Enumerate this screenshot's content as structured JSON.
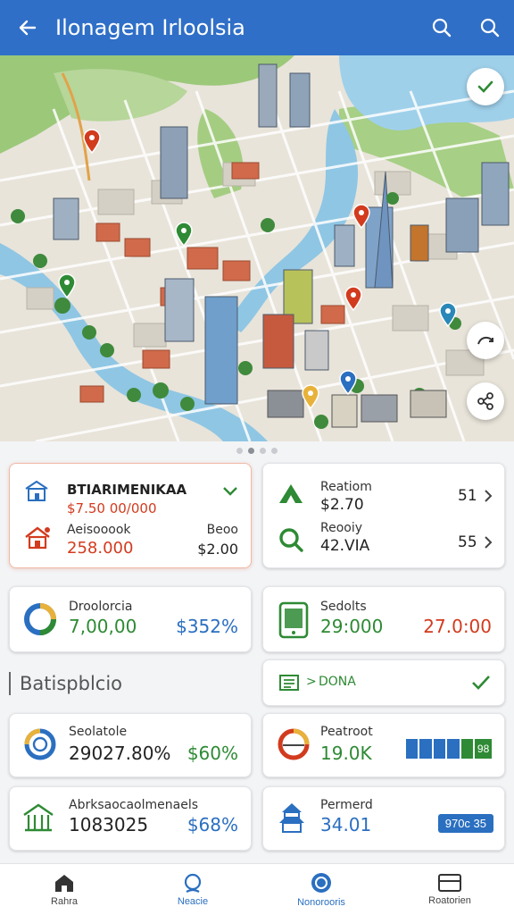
{
  "header": {
    "title": "Ilonagem Irloolsia",
    "back_icon": "arrow-left-icon",
    "search_icons": [
      "search-icon",
      "search-icon"
    ],
    "bg_color": "#2f6fc7"
  },
  "map": {
    "pager": {
      "count": 4,
      "active": 1
    }
  },
  "cards": {
    "c1": {
      "title": "BTIARIMENIKAA",
      "subtitle": "$7.50 00/000",
      "row_label": "Aeisooook",
      "row_value": "258.000",
      "right_label": "Beoo",
      "right_value": "$2.00"
    },
    "c2": {
      "label1": "Reatiom",
      "value1": "$2.70",
      "num1": "51",
      "label2": "Reooiy",
      "value2": "42.VIA",
      "num2": "55"
    },
    "c3": {
      "label": "Droolorcia",
      "value": "7,00,00",
      "percent": "$352%"
    },
    "c4": {
      "label": "Sedolts",
      "value": "29:000",
      "right_value": "27.0:00"
    },
    "c5": {
      "label": "DONA"
    },
    "c6": {
      "label": "Seolatole",
      "value": "29027.80%",
      "right_value": "$60%"
    },
    "c7": {
      "label": "Peatroot",
      "value": "19.0K",
      "badge": "98"
    },
    "c8": {
      "label": "Abrksaocaolmenaels",
      "value": "1083025",
      "right_value": "$68%"
    },
    "c9": {
      "label": "Permerd",
      "value": "34.01",
      "badge": "970c 35"
    }
  },
  "section": {
    "title": "Batispblcio"
  },
  "nav": [
    {
      "label": "Rahra",
      "icon": "home-icon"
    },
    {
      "label": "Neacie",
      "icon": "location-icon"
    },
    {
      "label": "Nonorooris",
      "icon": "compass-icon"
    },
    {
      "label": "Roatorien",
      "icon": "card-icon"
    }
  ],
  "colors": {
    "accent": "#2f6fc7",
    "red": "#d23b1e",
    "green": "#2e8a34",
    "blue": "#2a6fc0"
  }
}
